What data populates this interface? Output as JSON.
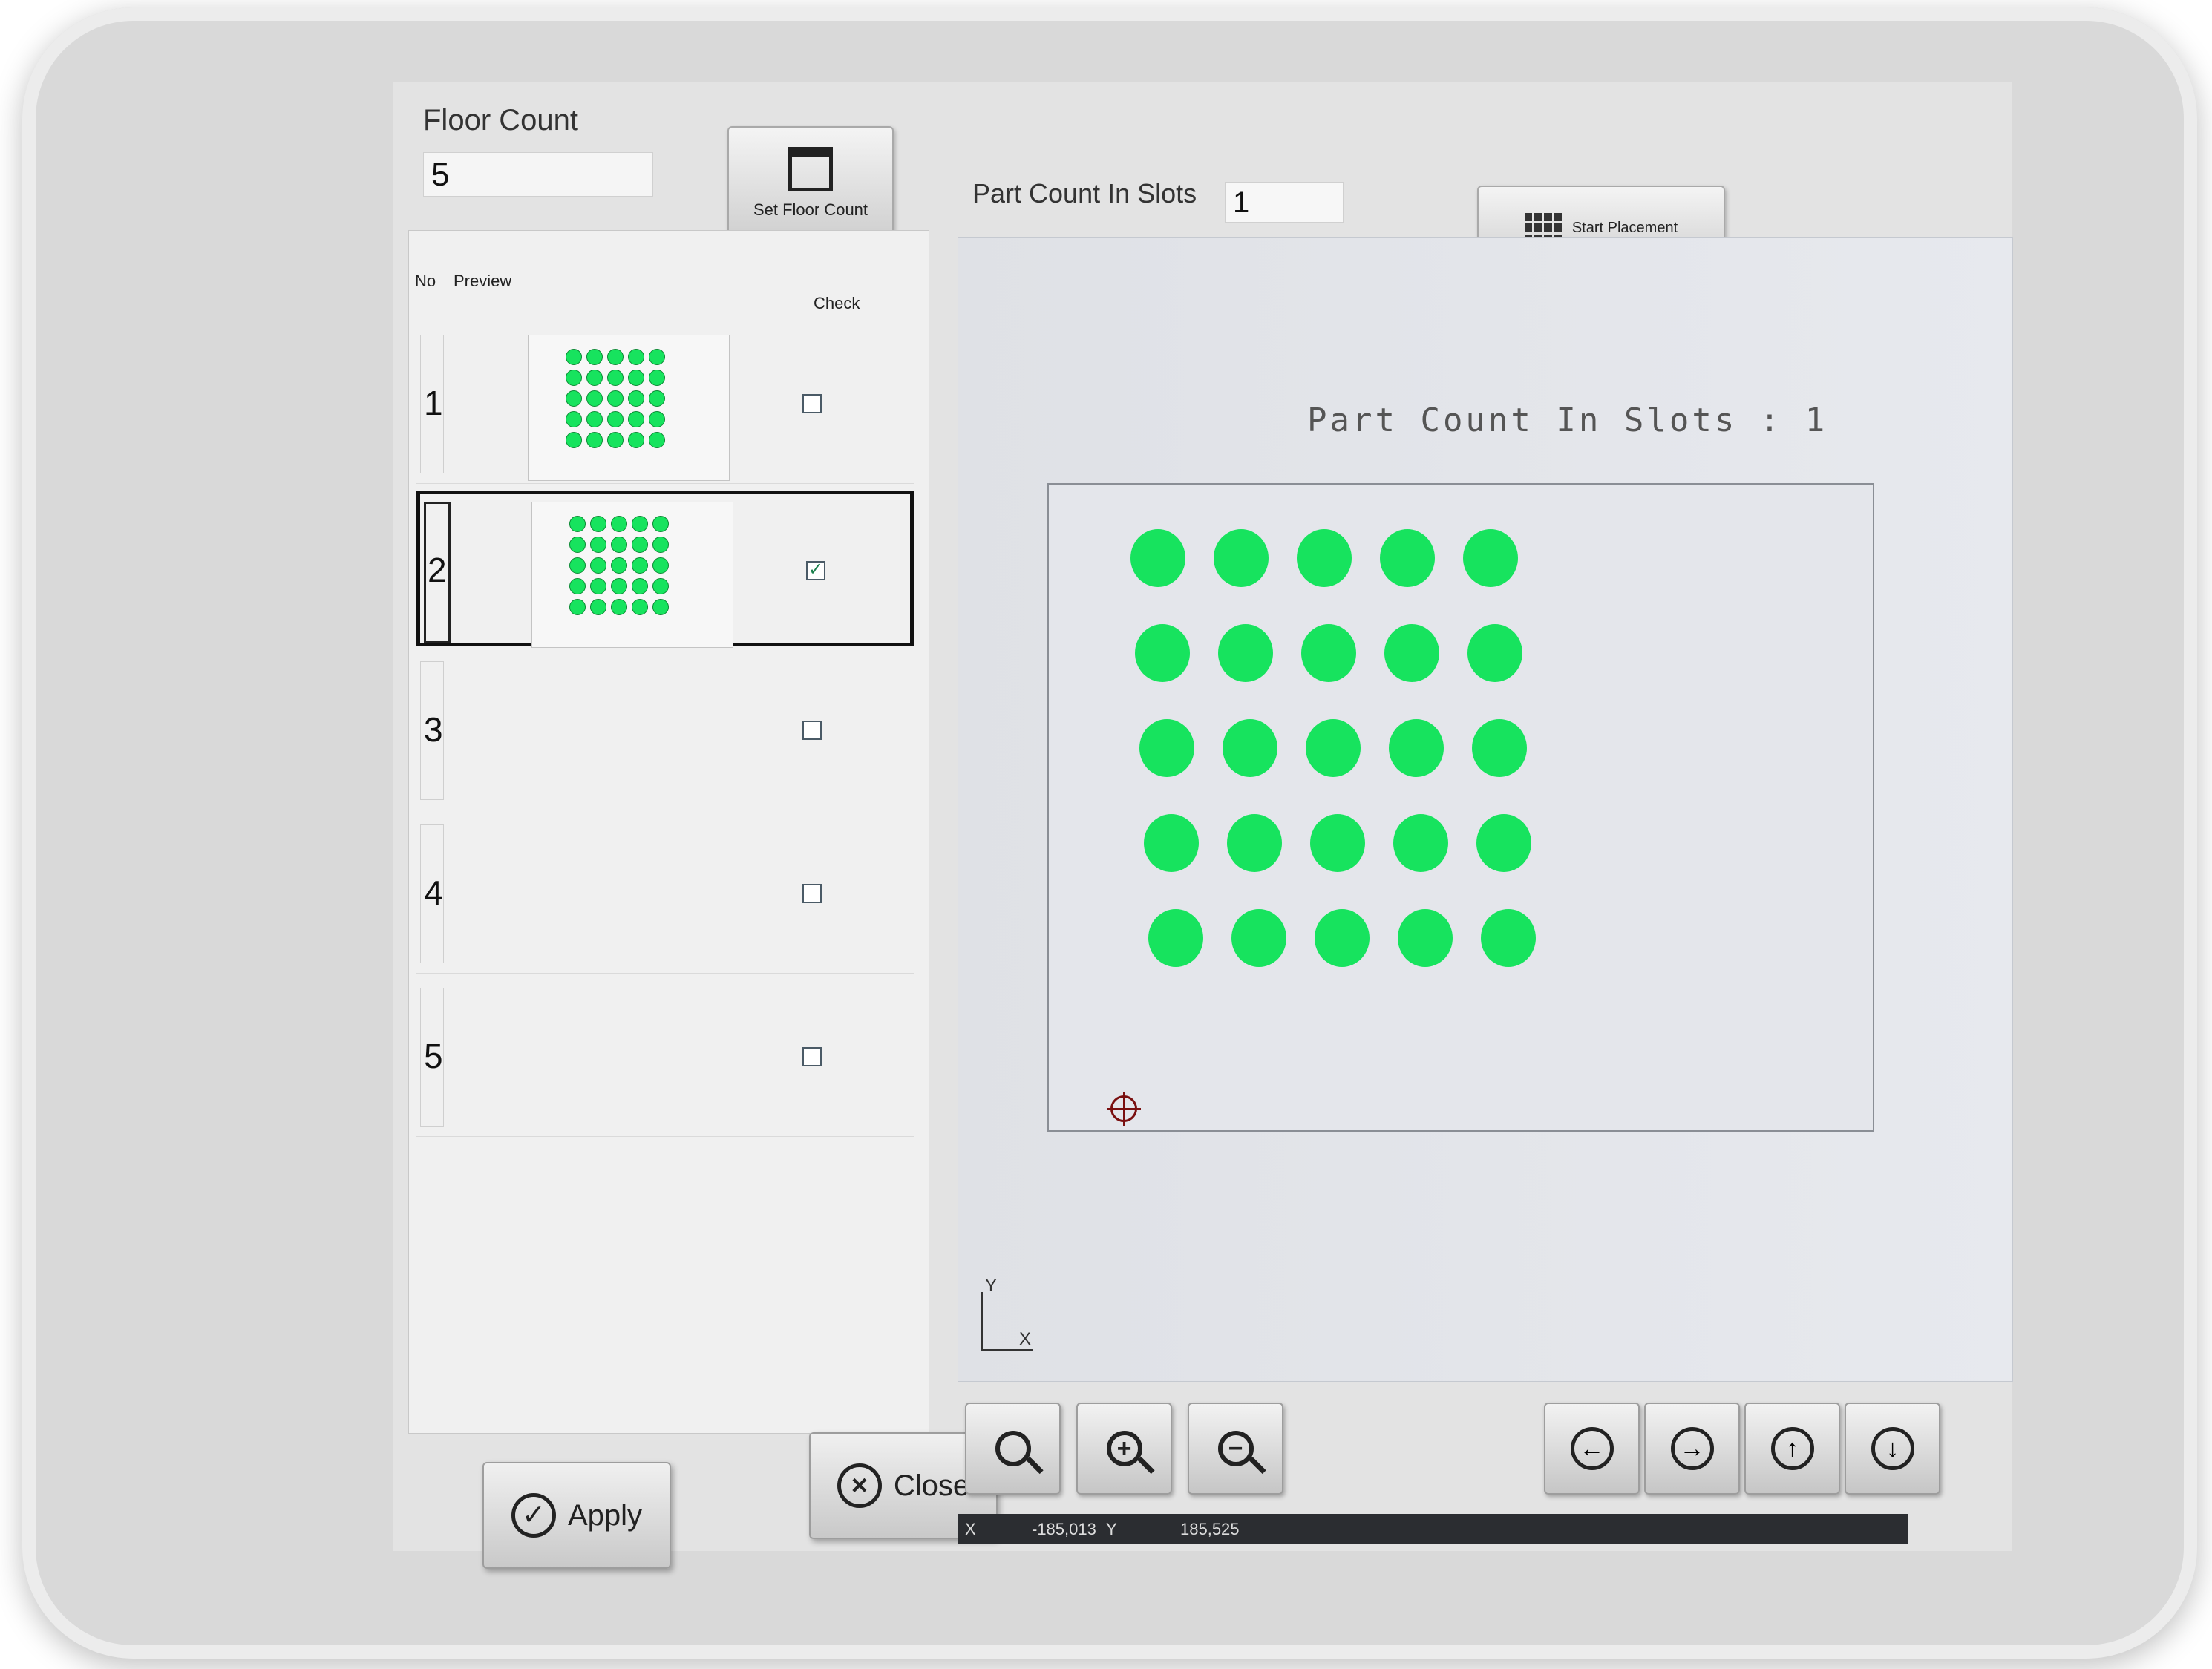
{
  "floor": {
    "label": "Floor Count",
    "value": "5",
    "set_button_label": "Set Floor Count"
  },
  "list": {
    "headers": {
      "no": "No",
      "preview": "Preview",
      "check": "Check"
    },
    "rows": [
      {
        "no": "1",
        "checked": false,
        "has_preview": true
      },
      {
        "no": "2",
        "checked": true,
        "has_preview": true,
        "selected": true
      },
      {
        "no": "3",
        "checked": false,
        "has_preview": false
      },
      {
        "no": "4",
        "checked": false,
        "has_preview": false
      },
      {
        "no": "5",
        "checked": false,
        "has_preview": false
      }
    ]
  },
  "actions": {
    "apply_label": "Apply",
    "close_label": "Close"
  },
  "placement": {
    "part_count_label": "Part Count In Slots",
    "part_count_value": "1",
    "start_button_label": "Start Placement",
    "canvas_title": "Part Count In Slots : 1",
    "grid_rows": 5,
    "grid_cols": 5
  },
  "axes": {
    "y": "Y",
    "x": "X"
  },
  "status": {
    "x_label": "X",
    "x_value": "-185,013",
    "y_label": "Y",
    "y_value": "185,525"
  },
  "icons": {
    "zoom": "search-icon",
    "zoom_in": "zoom-in-icon",
    "zoom_out": "zoom-out-icon",
    "left": "arrow-left-icon",
    "right": "arrow-right-icon",
    "up": "arrow-up-icon",
    "down": "arrow-down-icon"
  },
  "colors": {
    "part": "#17e35e",
    "accent_check": "#1a7f4c"
  }
}
